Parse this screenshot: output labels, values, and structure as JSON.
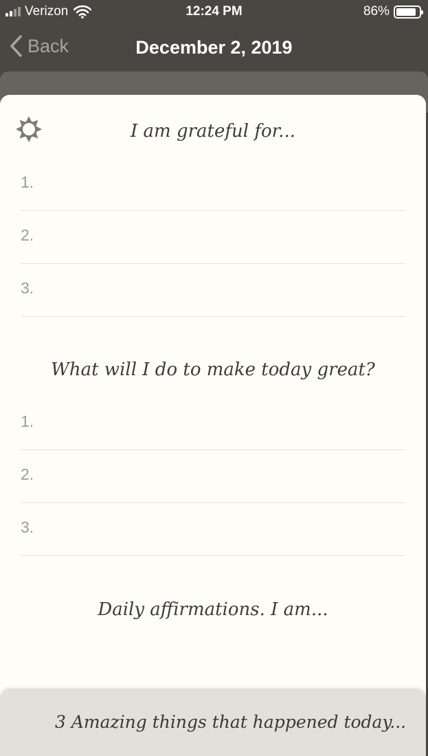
{
  "status": {
    "carrier": "Verizon",
    "time": "12:24 PM",
    "battery": "86%",
    "battery_level": 0.86
  },
  "nav": {
    "back_label": "Back",
    "title": "December 2, 2019"
  },
  "sections": {
    "grateful": {
      "heading": "I am grateful for...",
      "items": [
        "1.",
        "2.",
        "3."
      ]
    },
    "great_today": {
      "heading": "What will I do to make today great?",
      "items": [
        "1.",
        "2.",
        "3."
      ]
    },
    "affirmations": {
      "heading": "Daily affirmations. I am..."
    }
  },
  "bottom": {
    "label": "3 Amazing things that happened today..."
  },
  "icons": {
    "morning": "sun-icon",
    "evening": "moon-icon"
  }
}
